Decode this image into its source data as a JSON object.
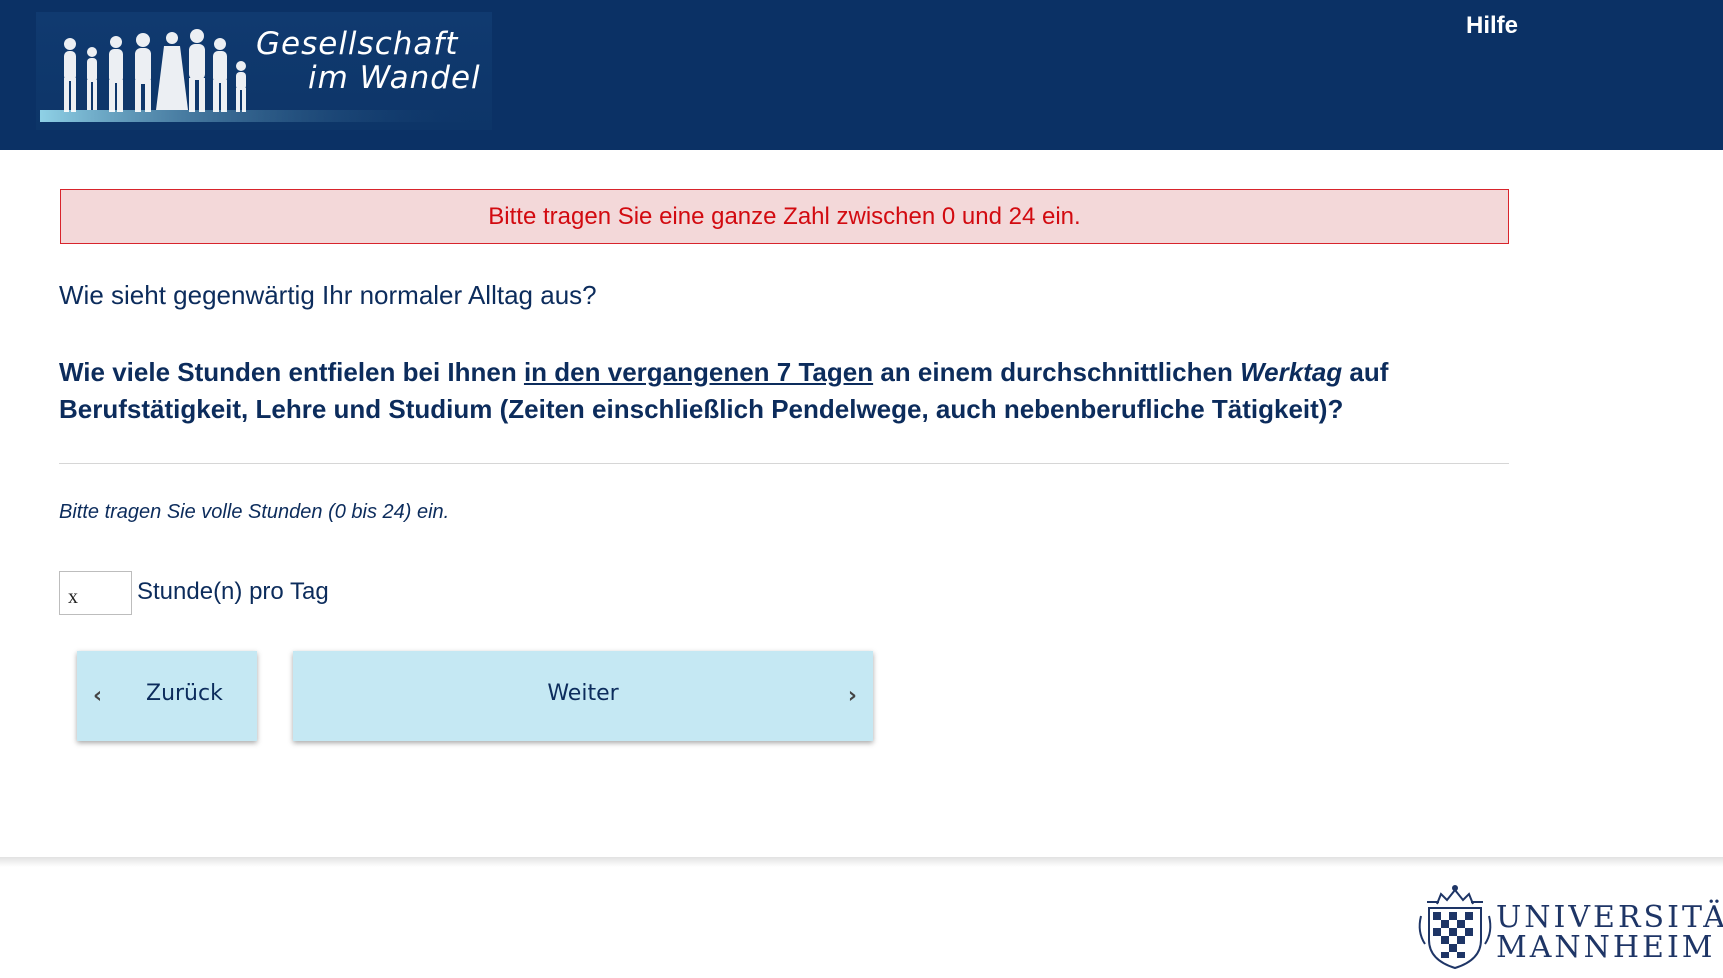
{
  "header": {
    "logo_line1": "Gesellschaft",
    "logo_line2": "im Wandel",
    "help_label": "Hilfe"
  },
  "error": {
    "message": "Bitte tragen Sie eine ganze Zahl zwischen 0 und 24 ein."
  },
  "survey": {
    "intro": "Wie sieht gegenwärtig Ihr normaler Alltag aus?",
    "question_part1": "Wie viele Stunden entfielen bei Ihnen ",
    "question_underlined": "in den vergangenen 7 Tagen",
    "question_part2": " an einem durchschnittlichen ",
    "question_italic": "Werktag",
    "question_part3": " auf Berufstätigkeit, Lehre und Studium (Zeiten einschließlich Pendelwege, auch nebenberufliche Tätigkeit)?",
    "hint": "Bitte tragen Sie volle Stunden (0 bis 24) ein.",
    "input_value": "x",
    "unit_label": "Stunde(n) pro Tag"
  },
  "nav": {
    "back_label": "Zurück",
    "next_label": "Weiter",
    "back_icon": "chevron-left-icon",
    "next_icon": "chevron-right-icon"
  },
  "footer": {
    "uni_line1": "UNIVERSITÄT",
    "uni_line2": "MANNHEIM"
  },
  "colors": {
    "header_bg": "#0b3165",
    "text": "#0c2c5c",
    "error_bg": "#f3d8d9",
    "error_border": "#d8242c",
    "error_text": "#d20a10",
    "button_bg": "#c5e8f3"
  }
}
